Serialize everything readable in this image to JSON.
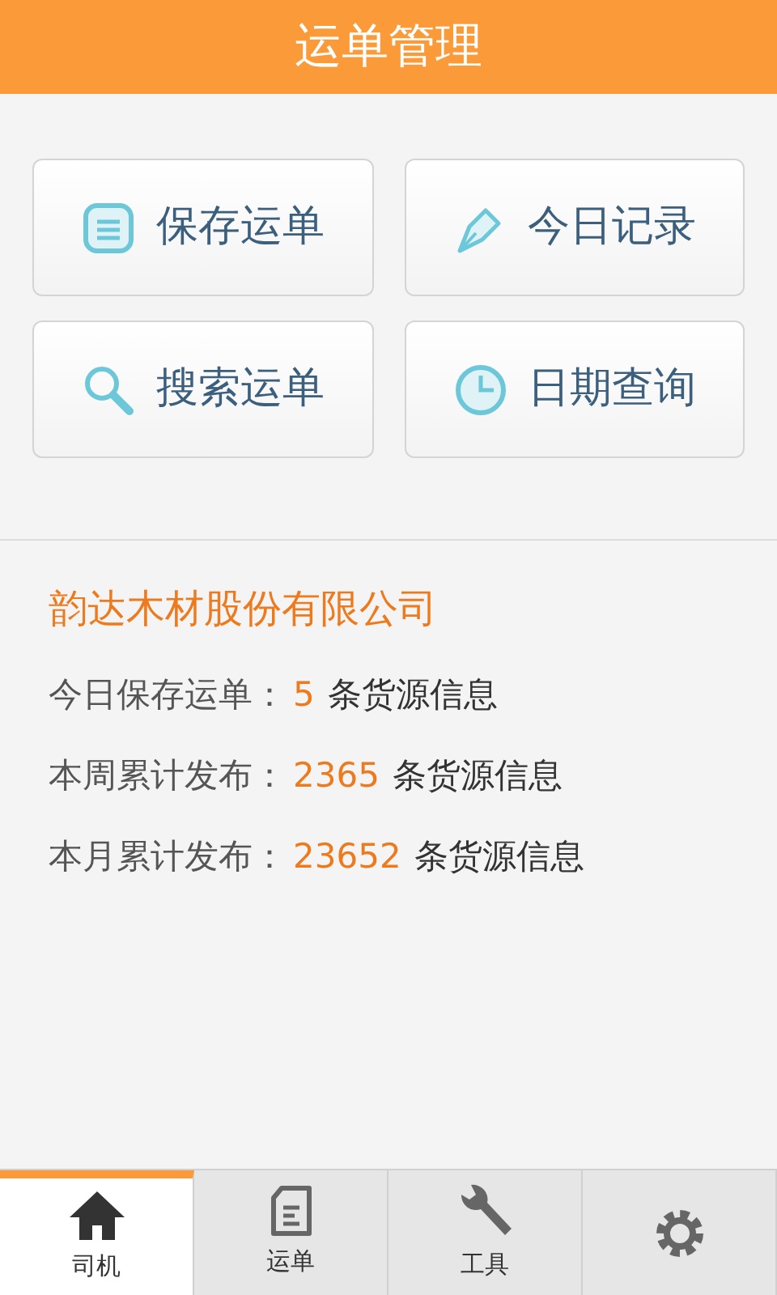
{
  "header": {
    "title": "运单管理"
  },
  "actions": [
    {
      "kind": "save",
      "label": "保存运单"
    },
    {
      "kind": "pen",
      "label": "今日记录"
    },
    {
      "kind": "search",
      "label": "搜索运单"
    },
    {
      "kind": "clock",
      "label": "日期查询"
    }
  ],
  "company": "韵达木材股份有限公司",
  "stats": [
    {
      "label": "今日保存运单：",
      "value": "5",
      "unit": "条货源信息"
    },
    {
      "label": "本周累计发布：",
      "value": "2365",
      "unit": "条货源信息"
    },
    {
      "label": "本月累计发布：",
      "value": "23652",
      "unit": "条货源信息"
    }
  ],
  "tabs": [
    {
      "kind": "home",
      "label": "司机",
      "selected": true
    },
    {
      "kind": "doc",
      "label": "运单",
      "selected": false
    },
    {
      "kind": "wrench",
      "label": "工具",
      "selected": false
    },
    {
      "kind": "gear",
      "selected": false
    }
  ]
}
